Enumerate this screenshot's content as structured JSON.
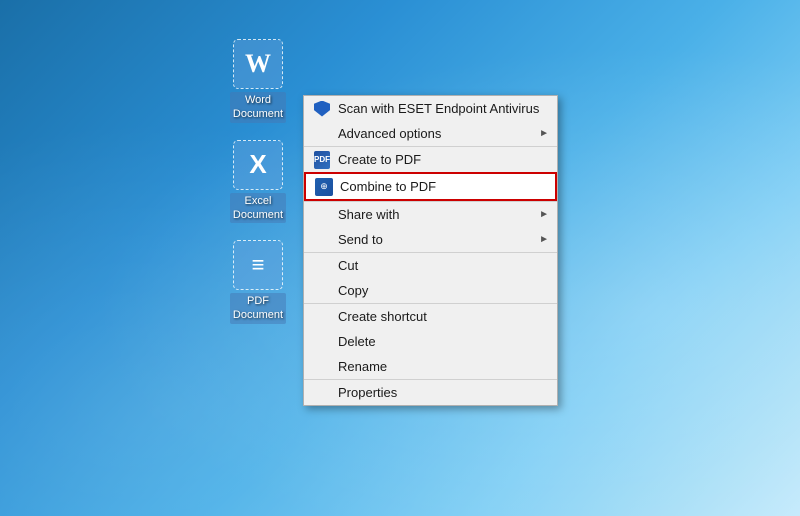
{
  "desktop": {
    "icons": [
      {
        "id": "word",
        "label": "Word\nDocument",
        "line1": "Word",
        "line2": "Document",
        "type": "word",
        "selected": true
      },
      {
        "id": "excel",
        "label": "Excel\nDocument",
        "line1": "Excel",
        "line2": "Document",
        "type": "excel",
        "selected": true
      },
      {
        "id": "pdf",
        "label": "PDF\nDocument",
        "line1": "PDF",
        "line2": "Document",
        "type": "pdf",
        "selected": true
      }
    ]
  },
  "context_menu": {
    "sections": [
      {
        "items": [
          {
            "id": "scan",
            "label": "Scan with ESET Endpoint Antivirus",
            "icon": "eset",
            "hasArrow": false
          },
          {
            "id": "advanced",
            "label": "Advanced options",
            "icon": "",
            "hasArrow": true
          }
        ]
      },
      {
        "items": [
          {
            "id": "create-pdf",
            "label": "Create to PDF",
            "icon": "pdf",
            "hasArrow": false
          },
          {
            "id": "combine-pdf",
            "label": "Combine to PDF",
            "icon": "combine",
            "hasArrow": false,
            "highlighted": true
          }
        ]
      },
      {
        "items": [
          {
            "id": "share",
            "label": "Share with",
            "icon": "",
            "hasArrow": true
          },
          {
            "id": "send-to",
            "label": "Send to",
            "icon": "",
            "hasArrow": true
          }
        ]
      },
      {
        "items": [
          {
            "id": "cut",
            "label": "Cut",
            "icon": "",
            "hasArrow": false
          },
          {
            "id": "copy",
            "label": "Copy",
            "icon": "",
            "hasArrow": false
          }
        ]
      },
      {
        "items": [
          {
            "id": "create-shortcut",
            "label": "Create shortcut",
            "icon": "",
            "hasArrow": false
          },
          {
            "id": "delete",
            "label": "Delete",
            "icon": "",
            "hasArrow": false
          },
          {
            "id": "rename",
            "label": "Rename",
            "icon": "",
            "hasArrow": false
          }
        ]
      },
      {
        "items": [
          {
            "id": "properties",
            "label": "Properties",
            "icon": "",
            "hasArrow": false
          }
        ]
      }
    ]
  }
}
